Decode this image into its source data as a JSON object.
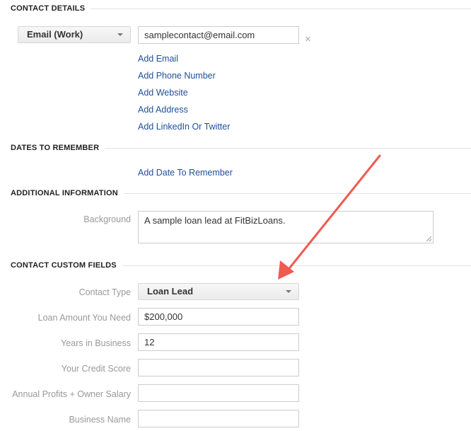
{
  "sections": {
    "contact_details": "CONTACT DETAILS",
    "dates_to_remember": "DATES TO REMEMBER",
    "additional_information": "ADDITIONAL INFORMATION",
    "contact_custom_fields": "CONTACT CUSTOM FIELDS"
  },
  "contact": {
    "email_type": "Email (Work)",
    "email_value": "samplecontact@email.com",
    "remove_symbol": "×",
    "links": [
      "Add Email",
      "Add Phone Number",
      "Add Website",
      "Add Address",
      "Add LinkedIn Or Twitter"
    ]
  },
  "dates": {
    "add_link": "Add Date To Remember"
  },
  "additional": {
    "background_label": "Background",
    "background_value": "A sample loan lead at FitBizLoans."
  },
  "custom_fields": {
    "contact_type_label": "Contact Type",
    "contact_type_value": "Loan Lead",
    "loan_amount_label": "Loan Amount You Need",
    "loan_amount_value": "$200,000",
    "years_label": "Years in Business",
    "years_value": "12",
    "credit_label": "Your Credit Score",
    "credit_value": "",
    "profits_label": "Annual Profits + Owner Salary",
    "profits_value": "",
    "business_label": "Business Name",
    "business_value": ""
  },
  "colors": {
    "link": "#1f4f9a",
    "annotation_arrow": "#f05a4f"
  }
}
